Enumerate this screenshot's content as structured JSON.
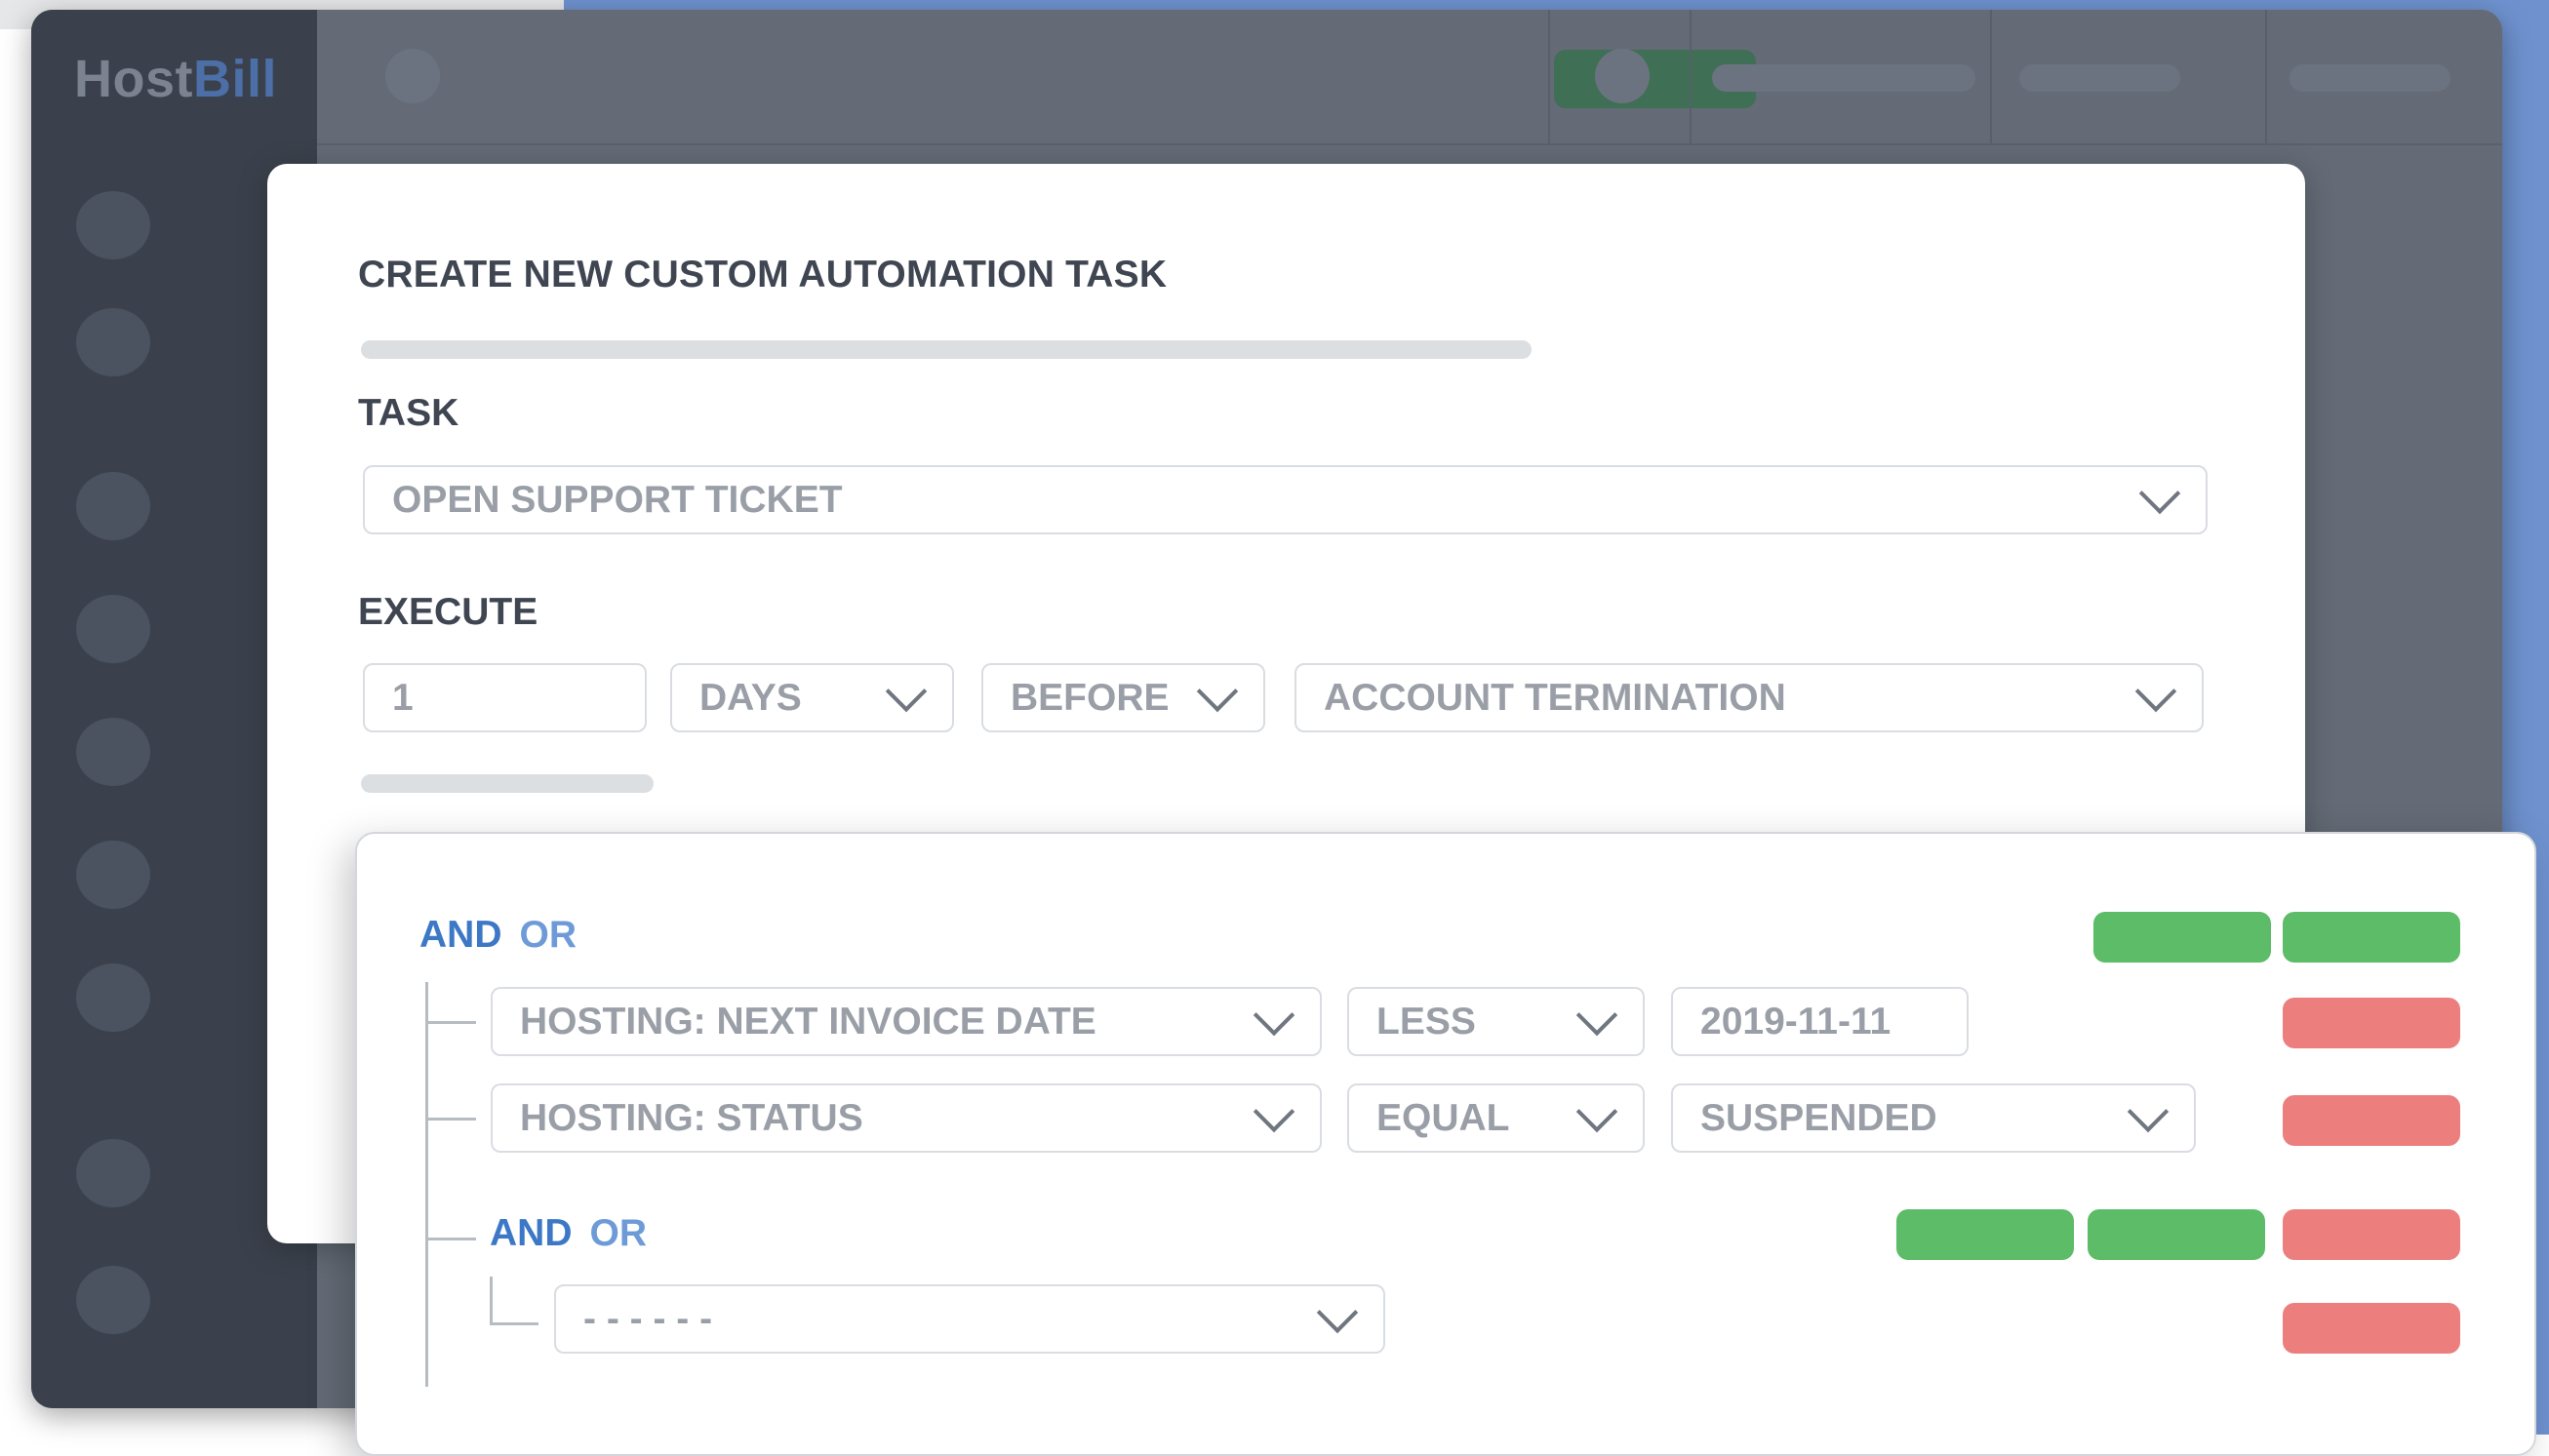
{
  "app": {
    "logo_part1": "Host",
    "logo_part2": "Bill"
  },
  "modal": {
    "title": "CREATE NEW CUSTOM AUTOMATION TASK",
    "task_label": "TASK",
    "task_value": "OPEN SUPPORT TICKET",
    "execute_label": "EXECUTE",
    "execute": {
      "amount": "1",
      "unit": "DAYS",
      "relation": "BEFORE",
      "event": "ACCOUNT TERMINATION"
    }
  },
  "conditions": {
    "and_label": "AND",
    "or_label": "OR",
    "rows": [
      {
        "field": "HOSTING: NEXT INVOICE DATE",
        "operator": "LESS",
        "value": "2019-11-11"
      },
      {
        "field": "HOSTING: STATUS",
        "operator": "EQUAL",
        "value": "SUSPENDED"
      }
    ],
    "subgroup": {
      "and_label": "AND",
      "or_label": "OR",
      "placeholder": "- - - - - -"
    }
  },
  "colors": {
    "add_button": "#5cbc67",
    "remove_button": "#ec7e7e",
    "and_color": "#3c78c6",
    "or_color": "#6e9bd8"
  }
}
